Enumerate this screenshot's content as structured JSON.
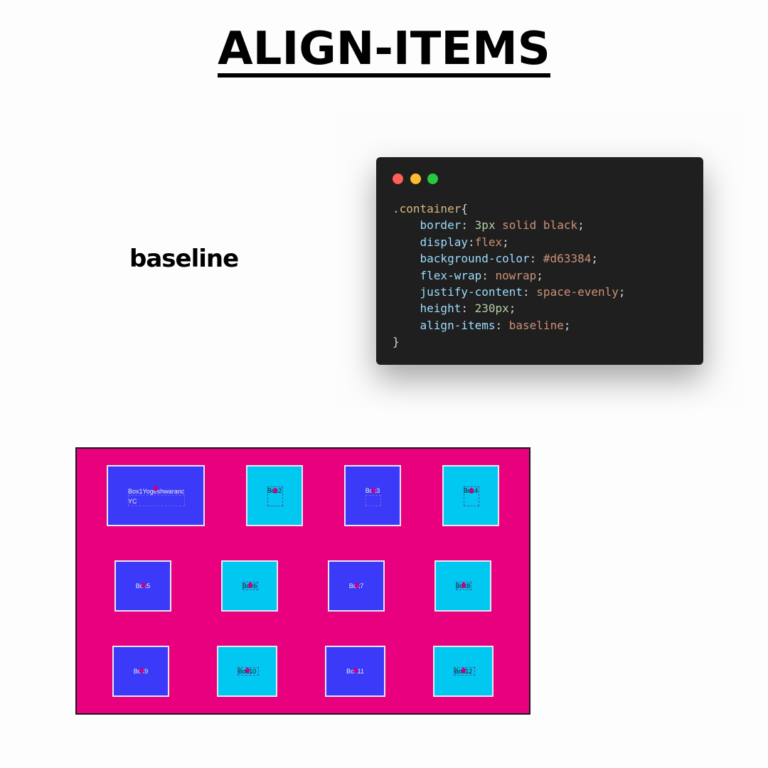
{
  "title": "ALIGN-ITEMS",
  "property_value_label": "baseline",
  "code": {
    "selector": ".container",
    "open_brace": "{",
    "close_brace": "}",
    "lines": [
      {
        "prop": "border",
        "num": "3px",
        "val": " solid black"
      },
      {
        "prop": "display",
        "val": "flex"
      },
      {
        "prop": "background-color",
        "val": "#d63384"
      },
      {
        "prop": "flex-wrap",
        "val": "nowrap"
      },
      {
        "prop": "justify-content",
        "val": "space-evenly"
      },
      {
        "prop": "height",
        "num": "230px"
      },
      {
        "prop": "align-items",
        "val": "baseline"
      }
    ]
  },
  "demo": {
    "boxes": [
      {
        "label_line1": "Box1Yogeshwaranc",
        "label_line2": "YC",
        "style": "blue"
      },
      {
        "label": "Box2",
        "style": "cyan"
      },
      {
        "label": "Box3",
        "style": "blue"
      },
      {
        "label": "Box4",
        "style": "cyan"
      },
      {
        "label": "Box5",
        "style": "blue"
      },
      {
        "label": "Box6",
        "style": "cyan"
      },
      {
        "label": "Box7",
        "style": "blue"
      },
      {
        "label": "Box8",
        "style": "cyan"
      },
      {
        "label": "Box9",
        "style": "blue"
      },
      {
        "label": "Box10",
        "style": "cyan"
      },
      {
        "label": "Box11",
        "style": "blue"
      },
      {
        "label": "Box12",
        "style": "cyan"
      }
    ]
  },
  "colors": {
    "demo_background": "#e8007e",
    "box_blue": "#3a3af8",
    "box_cyan": "#00c8f0",
    "code_background": "#1f1f1f"
  }
}
